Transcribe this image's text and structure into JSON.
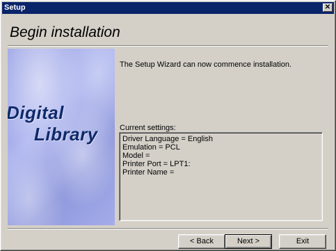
{
  "window": {
    "title": "Setup",
    "close_glyph": "✕"
  },
  "heading": "Begin installation",
  "banner": {
    "line1": "Digital",
    "line2": "Library"
  },
  "intro_text": "The Setup Wizard can now commence installation.",
  "settings": {
    "label": "Current settings:",
    "lines": [
      "Driver Language = English",
      "Emulation = PCL",
      "Model =",
      "Printer Port = LPT1:",
      "Printer Name ="
    ]
  },
  "buttons": {
    "back": "< Back",
    "next": "Next >",
    "exit": "Exit"
  }
}
